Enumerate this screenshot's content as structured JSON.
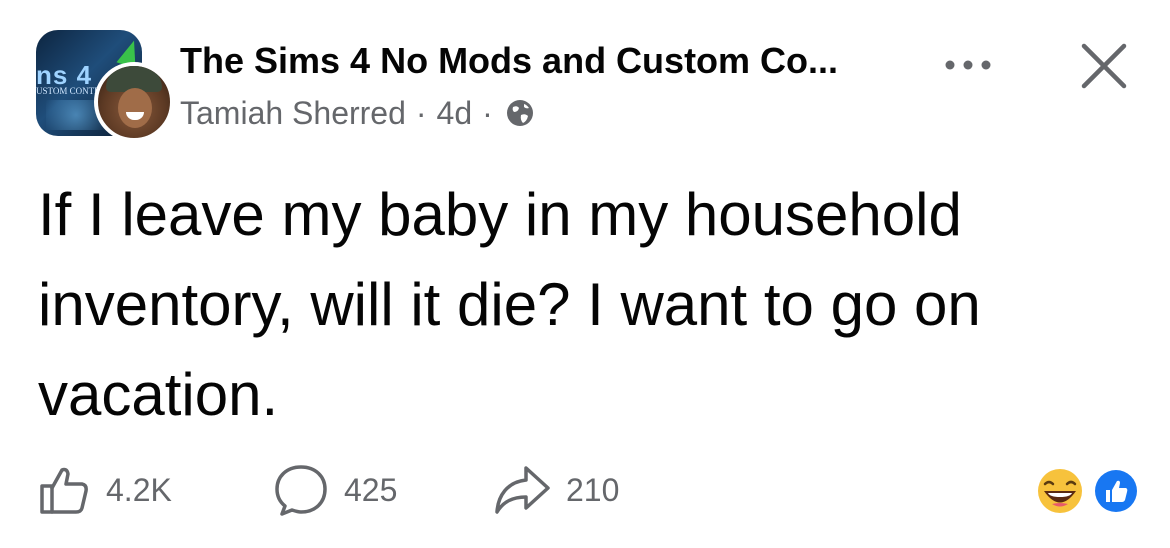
{
  "post": {
    "group_name": "The Sims 4 No Mods and Custom Co...",
    "author": "Tamiah Sherred",
    "time": "4d",
    "separator": "·",
    "body": "If I leave my baby in my household inventory, will it die? I want to go on vacation.",
    "group_avatar_text": "ns 4",
    "group_avatar_subtext": "USTOM CONTENT"
  },
  "actions": {
    "like_count": "4.2K",
    "comment_count": "425",
    "share_count": "210"
  },
  "icons": {
    "privacy": "globe-icon",
    "more": "more-options-icon",
    "close": "close-icon",
    "like": "thumbs-up-icon",
    "comment": "comment-bubble-icon",
    "share": "share-arrow-icon",
    "reaction_haha": "haha-emoji-icon",
    "reaction_like": "like-reaction-icon"
  },
  "colors": {
    "primary_text": "#050505",
    "secondary_text": "#65676b",
    "like_blue": "#1877f2",
    "haha_yellow": "#f7c23c"
  }
}
